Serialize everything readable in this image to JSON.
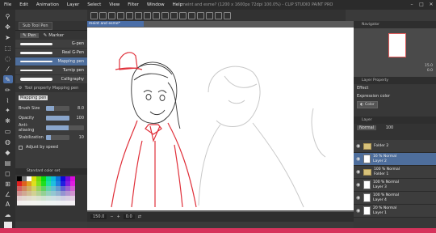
{
  "window": {
    "title": "meint and esme? (1200 x 1600px 72dpi 100.0%) - CLIP STUDIO PAINT PRO",
    "menu": [
      "File",
      "Edit",
      "Animation",
      "Layer",
      "Select",
      "View",
      "Filter",
      "Window",
      "Help"
    ]
  },
  "left_panel": {
    "subtool_tab": "Sub Tool Pen",
    "categories": [
      "Pen",
      "Marker"
    ],
    "brushes": [
      "G-pen",
      "Real G-Pen",
      "Mapping pen",
      "Turnip pen",
      "Calligraphy"
    ],
    "selected_brush": "Mapping pen",
    "tool_property_title": "Tool property Mapping pen",
    "properties": [
      {
        "label": "Brush Size",
        "value": "8.0",
        "fill": 0.35
      },
      {
        "label": "Opacity",
        "value": "100",
        "fill": 1.0
      },
      {
        "label": "Anti-aliasing",
        "value": "",
        "fill": 0.6
      },
      {
        "label": "Stabilization",
        "value": "10",
        "fill": 0.2
      }
    ],
    "adjust_by_speed": "Adjust by speed",
    "color_set_title": "Standard color set"
  },
  "canvas": {
    "tab_label": "meint and esme*",
    "zoom": "150.0",
    "rotate": "0.0"
  },
  "right_panel": {
    "navigator_title": "Navigator",
    "zoom_value": "15.0",
    "rotate_value": "0.0",
    "layer_property_title": "Layer Property",
    "effect_label": "Effect",
    "expression_color_label": "Expression color",
    "expression_color_value": "Color",
    "layer_header": "Layer",
    "blend_mode": "Normal",
    "opacity_value": "100",
    "layers": [
      {
        "opacity": "Folder 2",
        "name": "",
        "type": "folder"
      },
      {
        "opacity": "16 % Normal",
        "name": "Layer 2",
        "type": "layer"
      },
      {
        "opacity": "100 % Normal",
        "name": "Folder 1",
        "type": "folder"
      },
      {
        "opacity": "100 % Normal",
        "name": "Layer 3",
        "type": "layer"
      },
      {
        "opacity": "100 % Normal",
        "name": "Layer 4",
        "type": "layer"
      },
      {
        "opacity": "20 % Normal",
        "name": "Layer 1",
        "type": "layer"
      }
    ]
  },
  "colors": {
    "main": "#e8e8e8",
    "accent": "#d6335b",
    "selection": "#4e6e9c"
  }
}
